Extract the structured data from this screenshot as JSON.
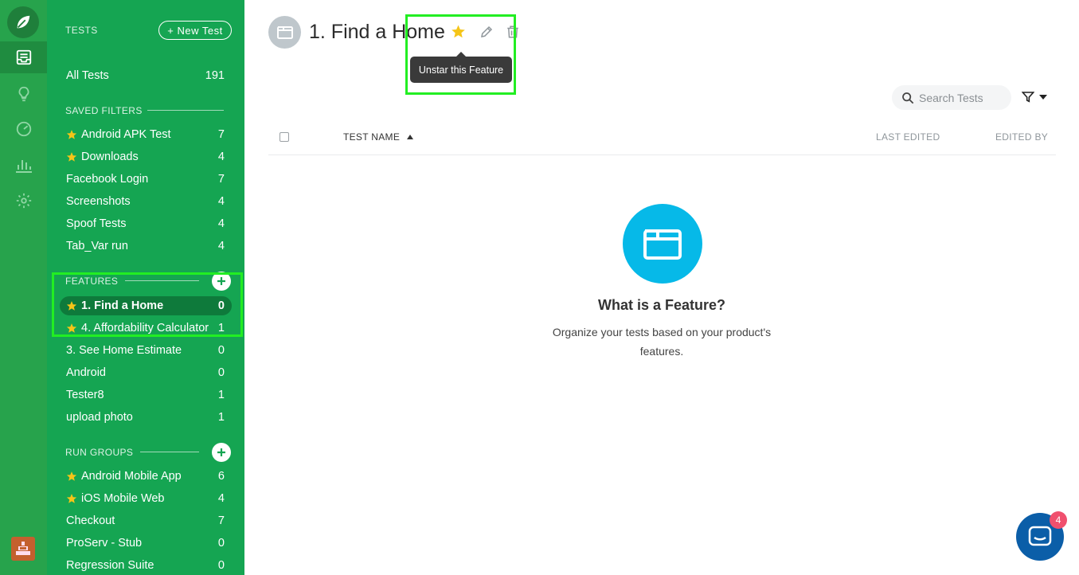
{
  "sidebar": {
    "tests_header": "TESTS",
    "new_test_label": "+ New Test",
    "all_tests": {
      "label": "All Tests",
      "count": "191"
    },
    "saved_filters_header": "SAVED FILTERS",
    "saved_filters": [
      {
        "label": "Android APK Test",
        "count": "7",
        "starred": true
      },
      {
        "label": "Downloads",
        "count": "4",
        "starred": true
      },
      {
        "label": "Facebook Login",
        "count": "7",
        "starred": false
      },
      {
        "label": "Screenshots",
        "count": "4",
        "starred": false
      },
      {
        "label": "Spoof Tests",
        "count": "4",
        "starred": false
      },
      {
        "label": "Tab_Var run",
        "count": "4",
        "starred": false
      }
    ],
    "features_header": "FEATURES",
    "features": [
      {
        "label": "1. Find a Home",
        "count": "0",
        "starred": true,
        "selected": true
      },
      {
        "label": "4. Affordability Calculator",
        "count": "1",
        "starred": true
      },
      {
        "label": "3. See Home Estimate",
        "count": "0",
        "starred": false
      },
      {
        "label": "Android",
        "count": "0",
        "starred": false
      },
      {
        "label": "Tester8",
        "count": "1",
        "starred": false
      },
      {
        "label": "upload photo",
        "count": "1",
        "starred": false
      }
    ],
    "run_groups_header": "RUN GROUPS",
    "run_groups": [
      {
        "label": "Android Mobile App",
        "count": "6",
        "starred": true
      },
      {
        "label": "iOS Mobile Web",
        "count": "4",
        "starred": true
      },
      {
        "label": "Checkout",
        "count": "7",
        "starred": false
      },
      {
        "label": "ProServ - Stub",
        "count": "0",
        "starred": false
      },
      {
        "label": "Regression Suite",
        "count": "0",
        "starred": false
      }
    ]
  },
  "main": {
    "title": "1. Find a Home",
    "tooltip": "Unstar this Feature",
    "search_placeholder": "Search Tests",
    "columns": {
      "name": "TEST NAME",
      "last_edited": "LAST EDITED",
      "edited_by": "EDITED BY"
    },
    "empty_title": "What is a Feature?",
    "empty_desc": "Organize your tests based on your product's features."
  },
  "chat": {
    "badge": "4"
  },
  "colors": {
    "sidebar": "#15a552",
    "rail": "#27a34c",
    "star": "#f5c518",
    "highlight": "#22ee22",
    "empty_icon": "#06b9e8"
  }
}
